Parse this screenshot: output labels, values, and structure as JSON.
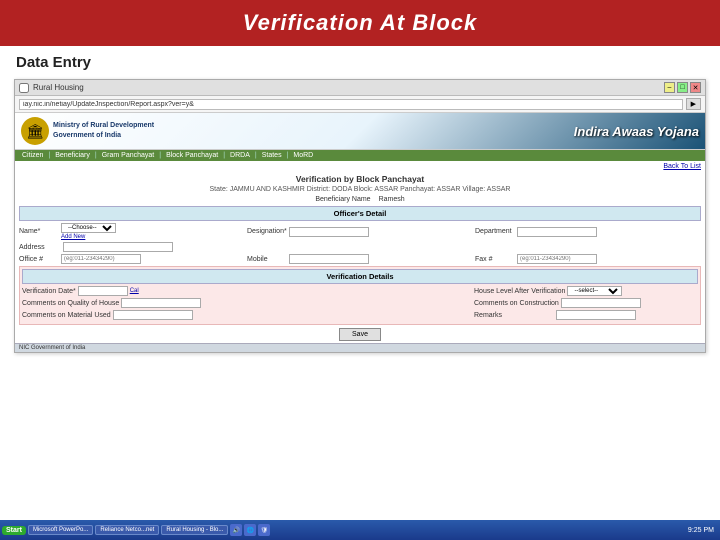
{
  "header": {
    "title": "Verification At Block"
  },
  "data_entry_label": "Data Entry",
  "browser": {
    "title": "Rural Housing",
    "url": "iay.nic.in/netiay/UpdateJnspection/Report.aspx?ver=y&",
    "controls": [
      "–",
      "□",
      "✕"
    ]
  },
  "iay": {
    "ministry_line1": "Ministry of Rural Development",
    "ministry_line2": "Government of India",
    "brand": "Indira Awaas Yojana",
    "nav_items": [
      "Citizen",
      "Beneficiary",
      "Gram Panchayat",
      "Block Panchayat",
      "DRDA",
      "States",
      "MoRD"
    ],
    "back_to_list": "Back To List"
  },
  "form": {
    "title": "Verification by Block Panchayat",
    "subtitle": "State: JAMMU AND KASHMIR  District: DODA  Block: ASSAR  Panchayat: ASSAR  Village: ASSAR",
    "beneficiary_name_label": "Beneficiary Name",
    "beneficiary_name_value": "Ramesh",
    "officers_detail_section": "Officer's Detail",
    "name_label": "Name*",
    "name_placeholder": "--Choose--",
    "add_new": "Add New",
    "designation_label": "Designation*",
    "department_label": "Department",
    "address_label": "Address",
    "office_ph_label": "Office #",
    "office_ph_placeholder": "(eg:011-23434290)",
    "mobile_label": "Mobile",
    "fax_label": "Fax #",
    "fax_placeholder": "(eg:011-23434290)",
    "verification_section": "Verification Details",
    "verification_date_label": "Verification Date*",
    "cal_link": "Cal",
    "house_level_label": "House Level After Verification",
    "house_level_placeholder": "--select--",
    "comments_quality_label": "Comments on Quality of House",
    "comments_construction_label": "Comments on Construction",
    "comments_material_label": "Comments on Material Used",
    "remarks_label": "Remarks",
    "submit_btn": "Save"
  },
  "footer": {
    "text": "NIC Government of India"
  },
  "taskbar": {
    "start_label": "Start",
    "items": [
      "Microsoft PowerPo...",
      "Reliance Netco...net",
      "Rural Housing - Blo..."
    ],
    "clock": "9:25 PM",
    "notification_icons": [
      "🔊",
      "🌐",
      "🛡"
    ]
  }
}
